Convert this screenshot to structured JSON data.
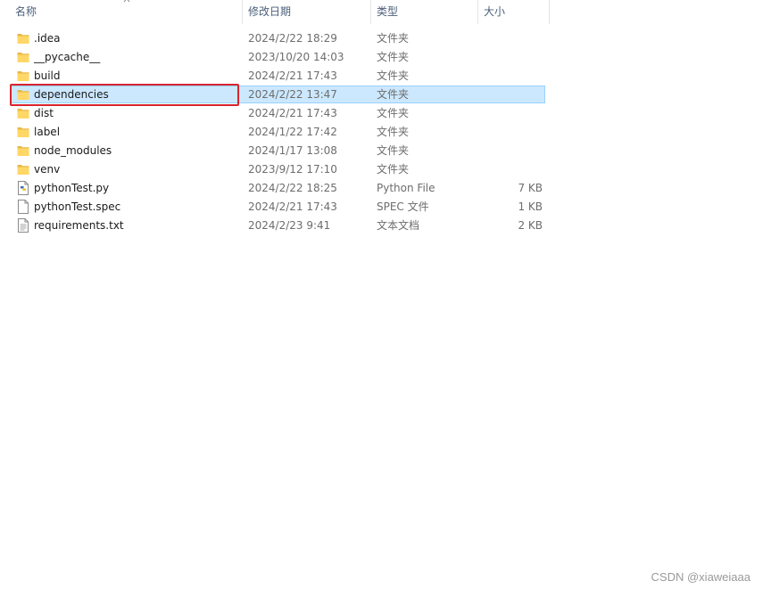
{
  "columns": {
    "name": "名称",
    "date": "修改日期",
    "type": "类型",
    "size": "大小"
  },
  "files": [
    {
      "name": ".idea",
      "date": "2024/2/22 18:29",
      "type": "文件夹",
      "size": "",
      "icon": "folder-icon",
      "selected": false
    },
    {
      "name": "__pycache__",
      "date": "2023/10/20 14:03",
      "type": "文件夹",
      "size": "",
      "icon": "folder-icon",
      "selected": false
    },
    {
      "name": "build",
      "date": "2024/2/21 17:43",
      "type": "文件夹",
      "size": "",
      "icon": "folder-icon",
      "selected": false
    },
    {
      "name": "dependencies",
      "date": "2024/2/22 13:47",
      "type": "文件夹",
      "size": "",
      "icon": "folder-icon",
      "selected": true
    },
    {
      "name": "dist",
      "date": "2024/2/21 17:43",
      "type": "文件夹",
      "size": "",
      "icon": "folder-icon",
      "selected": false
    },
    {
      "name": "label",
      "date": "2024/1/22 17:42",
      "type": "文件夹",
      "size": "",
      "icon": "folder-icon",
      "selected": false
    },
    {
      "name": "node_modules",
      "date": "2024/1/17 13:08",
      "type": "文件夹",
      "size": "",
      "icon": "folder-icon",
      "selected": false
    },
    {
      "name": "venv",
      "date": "2023/9/12 17:10",
      "type": "文件夹",
      "size": "",
      "icon": "folder-icon",
      "selected": false
    },
    {
      "name": "pythonTest.py",
      "date": "2024/2/22 18:25",
      "type": "Python File",
      "size": "7 KB",
      "icon": "python-file-icon",
      "selected": false
    },
    {
      "name": "pythonTest.spec",
      "date": "2024/2/21 17:43",
      "type": "SPEC 文件",
      "size": "1 KB",
      "icon": "blank-file-icon",
      "selected": false
    },
    {
      "name": "requirements.txt",
      "date": "2024/2/23 9:41",
      "type": "文本文档",
      "size": "2 KB",
      "icon": "text-file-icon",
      "selected": false
    }
  ],
  "colors": {
    "selection_fill": "#cce8ff",
    "selection_border": "#99d1ff",
    "annotation_red": "#d9232e",
    "folder_yellow": "#ffd766"
  },
  "watermark": "CSDN @xiaweiaaa"
}
